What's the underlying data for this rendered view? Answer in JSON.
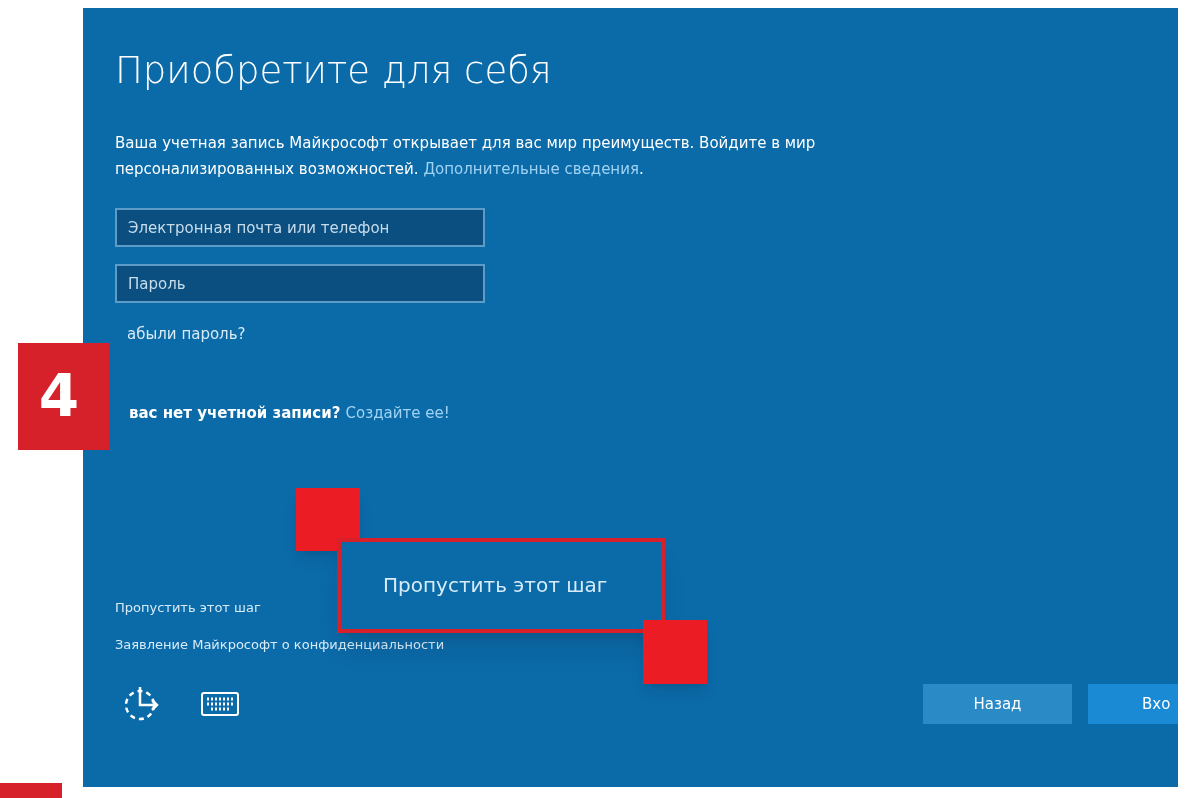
{
  "step_badge": "4",
  "heading": "Приобретите для себя",
  "intro": {
    "text": "Ваша учетная запись Майкрософт открывает для вас мир преимуществ. Войдите в мир персонализированных возможностей.",
    "link": "Дополнительные сведения",
    "end": "."
  },
  "fields": [
    {
      "placeholder": "Электронная почта или телефон"
    },
    {
      "placeholder": "Пароль"
    }
  ],
  "forgot_link": "абыли пароль?",
  "no_account": {
    "text": "вас нет учетной записи?",
    "link": "Создайте ее!"
  },
  "skip_link": "Пропустить этот шаг",
  "privacy_link": "Заявление Майкрософт о конфиденциальности",
  "callout": {
    "text": "Пропустить этот шаг"
  },
  "buttons": [
    {
      "label": "Назад",
      "kind": "secondary"
    },
    {
      "label": "Вхо",
      "kind": "primary"
    }
  ]
}
